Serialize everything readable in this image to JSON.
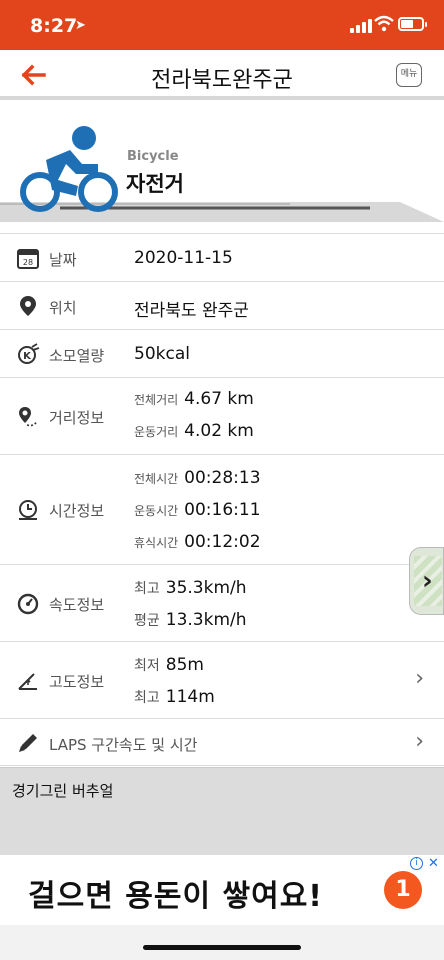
{
  "status": {
    "time": "8:27"
  },
  "nav": {
    "title": "전라북도완주군",
    "menu": "메뉴"
  },
  "hero": {
    "type_en": "Bicycle",
    "type_ko": "자전거"
  },
  "rows": {
    "date": {
      "label": "날짜",
      "value": "2020-11-15"
    },
    "location": {
      "label": "위치",
      "value": "전라북도 완주군"
    },
    "calories": {
      "label": "소모열량",
      "value": "50kcal"
    },
    "distance": {
      "label": "거리정보",
      "total_label": "전체거리",
      "total": "4.67 km",
      "moving_label": "운동거리",
      "moving": "4.02 km"
    },
    "time": {
      "label": "시간정보",
      "total_label": "전체시간",
      "total": "00:28:13",
      "moving_label": "운동시간",
      "moving": "00:16:11",
      "rest_label": "휴식시간",
      "rest": "00:12:02"
    },
    "speed": {
      "label": "속도정보",
      "max_label": "최고",
      "max": "35.3km/h",
      "avg_label": "평균",
      "avg": "13.3km/h"
    },
    "altitude": {
      "label": "고도정보",
      "min_label": "최저",
      "min": "85m",
      "max_label": "최고",
      "max": "114m"
    },
    "laps": {
      "label": "LAPS 구간속도 및 시간"
    }
  },
  "footer": {
    "section": "경기그린 버추얼"
  },
  "ad": {
    "text": "걸으면 용돈이 쌓여요!",
    "badge": "1"
  },
  "colors": {
    "accent": "#e2451b",
    "icon_blue": "#1f6fb5"
  }
}
